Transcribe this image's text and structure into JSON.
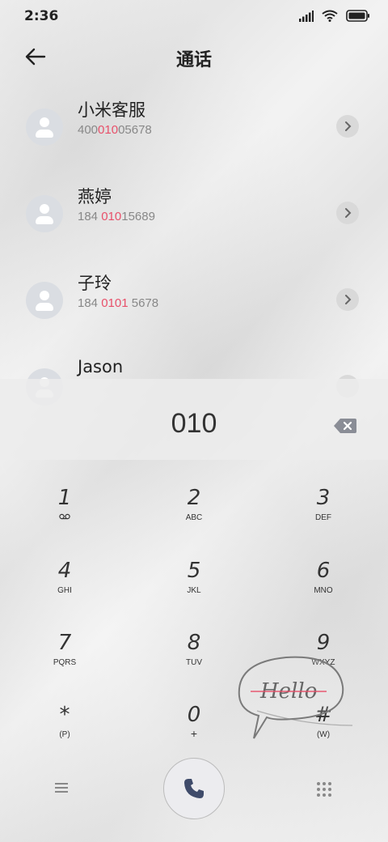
{
  "status": {
    "time": "2:36"
  },
  "header": {
    "title": "通话"
  },
  "contacts": [
    {
      "name": "小米客服",
      "num_pre": "400",
      "num_hl": "010",
      "num_post": "05678"
    },
    {
      "name": "燕婷",
      "num_pre": "184 ",
      "num_hl": "010",
      "num_post": "15689"
    },
    {
      "name": "子玲",
      "num_pre": "184 ",
      "num_hl": "0101",
      "num_post": " 5678"
    },
    {
      "name": "Jason"
    }
  ],
  "dialer": {
    "number": "010",
    "keys": [
      {
        "digit": "1",
        "letters": ""
      },
      {
        "digit": "2",
        "letters": "ABC"
      },
      {
        "digit": "3",
        "letters": "DEF"
      },
      {
        "digit": "4",
        "letters": "GHI"
      },
      {
        "digit": "5",
        "letters": "JKL"
      },
      {
        "digit": "6",
        "letters": "MNO"
      },
      {
        "digit": "7",
        "letters": "PQRS"
      },
      {
        "digit": "8",
        "letters": "TUV"
      },
      {
        "digit": "9",
        "letters": "WXYZ"
      },
      {
        "digit": "*",
        "letters": "(P)"
      },
      {
        "digit": "0",
        "letters": "+"
      },
      {
        "digit": "#",
        "letters": "(W)"
      }
    ]
  },
  "decoration": {
    "sticker_text": "Hello"
  },
  "icons": {
    "back": "arrow-left-icon",
    "backspace": "backspace-icon",
    "voicemail": "voicemail-icon",
    "call": "phone-icon",
    "menu": "menu-icon",
    "keypad": "keypad-icon"
  },
  "colors": {
    "highlight": "#e8506a",
    "avatar_bg": "#dadde2"
  }
}
